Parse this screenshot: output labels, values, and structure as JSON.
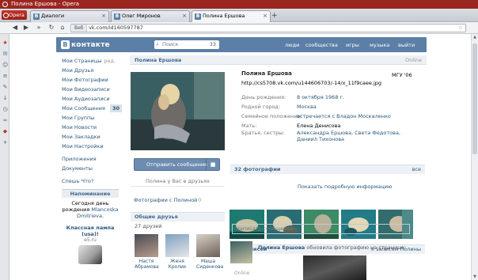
{
  "window": {
    "title": "Полина Ершова - Opera"
  },
  "browser": {
    "menu_label": "Opera",
    "tabs": [
      {
        "label": "Диалоги",
        "favicon": "vk-favicon"
      },
      {
        "label": "Олег Миронов",
        "favicon": "vk-favicon"
      },
      {
        "label": "Полина Ершова",
        "favicon": "vk-favicon",
        "active": true
      }
    ],
    "address": {
      "tag": "Веб",
      "url": "vk.com/id160597787"
    }
  },
  "header": {
    "logo_letter": "В",
    "logo_text": "контакте",
    "search_placeholder": "Поиск",
    "search_count": "33",
    "nav": [
      "люди",
      "сообщества",
      "игры",
      "музыка",
      "выйти"
    ]
  },
  "left_menu": {
    "items": [
      {
        "label": "Мои Страницы",
        "extra": "ред."
      },
      {
        "label": "Мои Друзья"
      },
      {
        "label": "Мои Фотографии"
      },
      {
        "label": "Мои Видеозаписи"
      },
      {
        "label": "Мои Аудиозаписи"
      },
      {
        "label": "Мои Сообщения",
        "badge": "30"
      },
      {
        "label": "Мои Группы"
      },
      {
        "label": "Мои Новости"
      },
      {
        "label": "Мои Закладки"
      },
      {
        "label": "Мои Настройки"
      }
    ],
    "items2": [
      {
        "label": "Приложения"
      },
      {
        "label": "Документы"
      }
    ],
    "items3": [
      {
        "label": "Спешь Что?"
      }
    ],
    "reminder": {
      "title": "Напоминание",
      "line1": "Сегодня день",
      "line2": "рождения",
      "link": "Mlancoska Dmitrieva."
    },
    "ad": {
      "title": "Классная лампа (usa)!",
      "source": "e5.ru"
    }
  },
  "profile": {
    "name": "Полина Ершова",
    "status_label": "Online",
    "full_name": "Полина Ершова",
    "school": "МГУ '06",
    "status_text": "http://cs5708.vk.com/u144606703/-14/x_11f9caee.jpg",
    "info": [
      {
        "key": "День рождения:",
        "value": "8 октября 1968 г."
      },
      {
        "key": "Родной город:",
        "value": "Москва"
      },
      {
        "key": "Семейное положение:",
        "value": "встречается с Владон Москаленко"
      },
      {
        "key": "Мать:",
        "value": "Елена Денисова"
      },
      {
        "key": "Братья, сестры:",
        "value": "Александра Ершова, Света Федотова, Даниил Тихонова"
      }
    ],
    "show_more": "Показать подробную информацию",
    "send_message": "Отправить сообщение",
    "friends_line": "Полина у Вас в друзьях",
    "photos_with_label": "Фотографии с Полиной",
    "photos_with_count": "0"
  },
  "common_friends": {
    "title": "Общие друзья",
    "count_text": "27 друзей",
    "friends": [
      {
        "name": "Настя Абрамова"
      },
      {
        "name": "Женя Кролик"
      },
      {
        "name": "Маша Сиденкова"
      }
    ]
  },
  "photos_block": {
    "title": "32 фотографии",
    "action": "все",
    "photos": [
      {
        "name": "photo-1",
        "tone": "#1e7a70"
      },
      {
        "name": "photo-2",
        "tone": "#2a6c73"
      },
      {
        "name": "photo-3",
        "tone": "#3c8a66"
      },
      {
        "name": "photo-4",
        "tone": "#247b88"
      },
      {
        "name": "photo-5",
        "tone": "#336c6c"
      }
    ]
  },
  "wall": {
    "title": "36 записей",
    "action": "к записям Полины",
    "input_placeholder": "Написать сообщение...",
    "post_author": "Полина Ершова",
    "post_action": "обновила фотографию на странице:",
    "online": "Online"
  }
}
